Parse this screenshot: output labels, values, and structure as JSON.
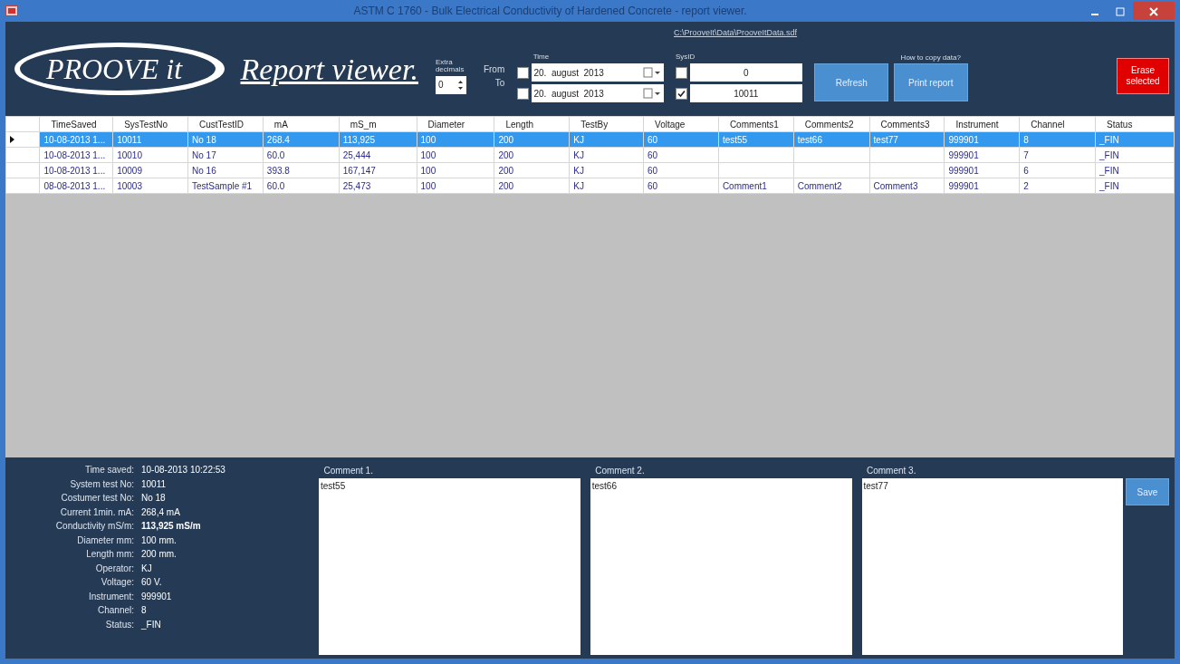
{
  "window": {
    "title": "ASTM C 1760 - Bulk Electrical Conductivity of Hardened Concrete - report viewer."
  },
  "header": {
    "logo": "PROOVE it",
    "heading": "Report viewer.",
    "file_link": "C:\\ProoveIt\\Data\\ProoveItData.sdf",
    "extra_decimals": {
      "label": "Extra decimals",
      "value": "0"
    },
    "from_label": "From",
    "to_label": "To",
    "time": {
      "label": "Time",
      "from": {
        "checked": false,
        "value": "20.  august  2013"
      },
      "to": {
        "checked": false,
        "value": "20.  august  2013"
      }
    },
    "sysid": {
      "label": "SysID",
      "from": {
        "checked": false,
        "value": "0"
      },
      "to": {
        "checked": true,
        "value": "10011"
      }
    },
    "refresh": "Refresh",
    "copy_hint": "How to copy data?",
    "print": "Print report",
    "erase": "Erase selected"
  },
  "table": {
    "columns": [
      "TimeSaved",
      "SysTestNo",
      "CustTestID",
      "mA",
      "mS_m",
      "Diameter",
      "Length",
      "TestBy",
      "Voltage",
      "Comments1",
      "Comments2",
      "Comments3",
      "Instrument",
      "Channel",
      "Status"
    ],
    "rows": [
      {
        "selected": true,
        "cells": [
          "10-08-2013 1...",
          "10011",
          "No 18",
          "268.4",
          "113,925",
          "100",
          "200",
          "KJ",
          "60",
          "test55",
          "test66",
          "test77",
          "999901",
          "8",
          "_FIN"
        ]
      },
      {
        "selected": false,
        "cells": [
          "10-08-2013 1...",
          "10010",
          "No 17",
          "60.0",
          "25,444",
          "100",
          "200",
          "KJ",
          "60",
          "",
          "",
          "",
          "999901",
          "7",
          "_FIN"
        ]
      },
      {
        "selected": false,
        "cells": [
          "10-08-2013 1...",
          "10009",
          "No 16",
          "393.8",
          "167,147",
          "100",
          "200",
          "KJ",
          "60",
          "",
          "",
          "",
          "999901",
          "6",
          "_FIN"
        ]
      },
      {
        "selected": false,
        "cells": [
          "08-08-2013 1...",
          "10003",
          "TestSample #1",
          "60.0",
          "25,473",
          "100",
          "200",
          "KJ",
          "60",
          "Comment1",
          "Comment2",
          "Comment3",
          "999901",
          "2",
          "_FIN"
        ]
      }
    ]
  },
  "details": [
    {
      "label": "Time saved:",
      "value": "10-08-2013 10:22:53",
      "emphasis": false
    },
    {
      "label": "System test No:",
      "value": "10011",
      "emphasis": false
    },
    {
      "label": "Costumer test No:",
      "value": "No 18",
      "emphasis": false
    },
    {
      "label": "Current 1min. mA:",
      "value": "268,4 mA",
      "emphasis": false
    },
    {
      "label": "Conductivity mS/m:",
      "value": "113,925 mS/m",
      "emphasis": true
    },
    {
      "label": "Diameter mm:",
      "value": "100 mm.",
      "emphasis": false
    },
    {
      "label": "Length mm:",
      "value": "200 mm.",
      "emphasis": false
    },
    {
      "label": "Operator:",
      "value": "KJ",
      "emphasis": false
    },
    {
      "label": "Voltage:",
      "value": "60 V.",
      "emphasis": false
    },
    {
      "label": "Instrument:",
      "value": "999901",
      "emphasis": false
    },
    {
      "label": "Channel:",
      "value": "8",
      "emphasis": false
    },
    {
      "label": "Status:",
      "value": "_FIN",
      "emphasis": false
    }
  ],
  "comments": [
    {
      "label": "Comment 1.",
      "value": "test55"
    },
    {
      "label": "Comment 2.",
      "value": "test66"
    },
    {
      "label": "Comment 3.",
      "value": "test77"
    }
  ],
  "save": "Save"
}
